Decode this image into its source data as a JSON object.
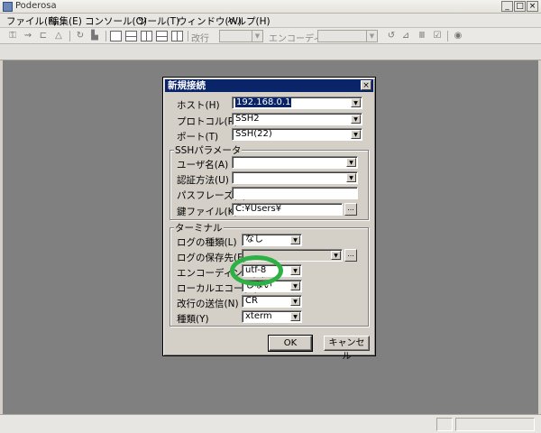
{
  "window": {
    "title": "Poderosa",
    "min": "_",
    "max": "□",
    "close": "×"
  },
  "menu": [
    "ファイル(F)",
    "編集(E)",
    "コンソール(O)",
    "ツール(T)",
    "ウィンドウ(W)",
    "ヘルプ(H)"
  ],
  "toolbar": {
    "newline_label": "改行",
    "encoding_label": "エンコーディング"
  },
  "dialog": {
    "title": "新規接続",
    "close": "×",
    "host_label": "ホスト(H)",
    "host_value": "192.168.0.1",
    "protocol_label": "プロトコル(R)",
    "protocol_value": "SSH2",
    "port_label": "ポート(T)",
    "port_value": "SSH(22)",
    "ssh_group": "SSHパラメータ",
    "user_label": "ユーザ名(A)",
    "user_value": "",
    "auth_label": "認証方法(U)",
    "auth_value": "",
    "pass_label": "パスフレーズ(P)",
    "key_label": "鍵ファイル(K)",
    "key_value": "C:¥Users¥",
    "browse": "...",
    "terminal_group": "ターミナル",
    "logtype_label": "ログの種類(L)",
    "logtype_value": "なし",
    "logpath_label": "ログの保存先(F)",
    "encoding_label": "エンコーディング(E)",
    "encoding_value": "utf-8",
    "localecho_label": "ローカルエコー(O)",
    "localecho_value": "しない",
    "newline_label": "改行の送信(N)",
    "newline_value": "CR",
    "type_label": "種類(Y)",
    "type_value": "xterm",
    "ok": "OK",
    "cancel": "キャンセル"
  },
  "colors": {
    "annotation": "#2db144",
    "dialog_title_bg": "#0a246a",
    "workspace": "#808080"
  }
}
